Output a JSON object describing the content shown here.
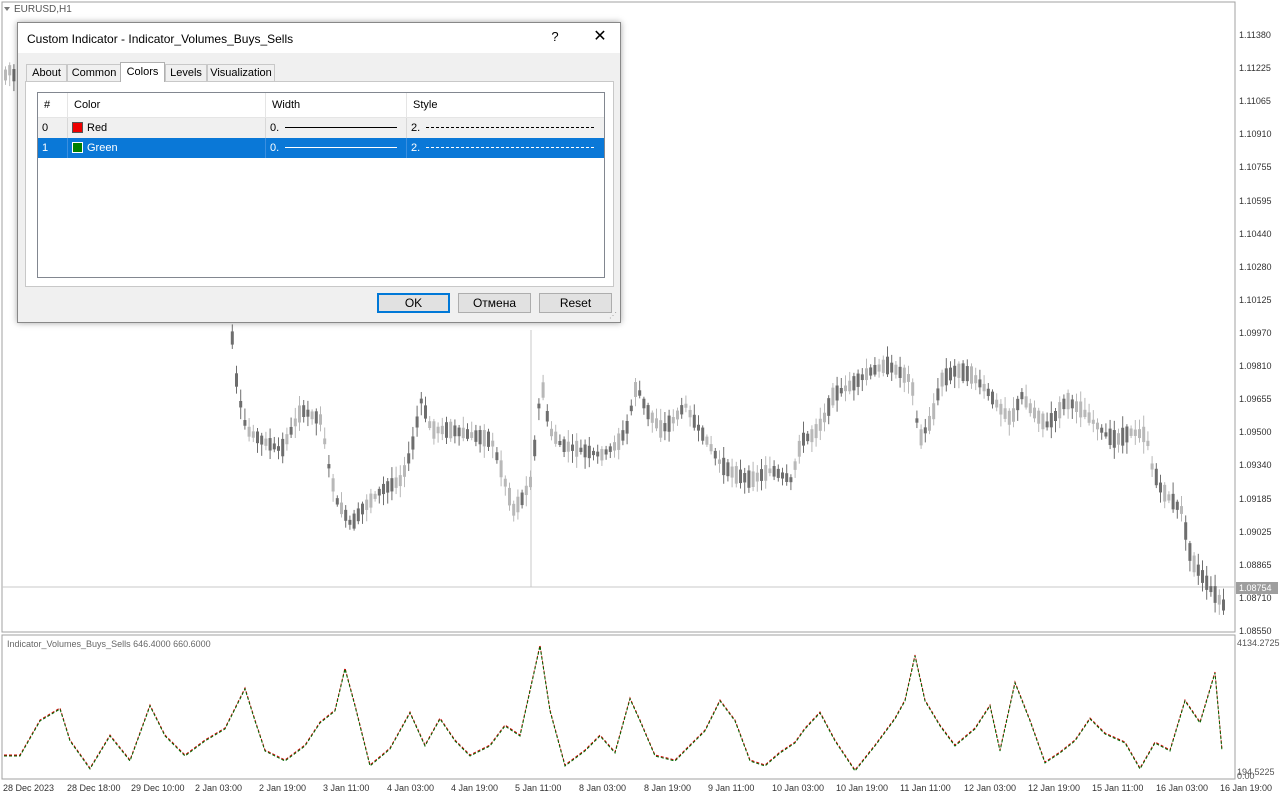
{
  "chart": {
    "symbol_title": "EURUSD,H1",
    "price_axis": [
      "1.11380",
      "1.11225",
      "1.11065",
      "1.10910",
      "1.10755",
      "1.10595",
      "1.10440",
      "1.10280",
      "1.10125",
      "1.09970",
      "1.09810",
      "1.09655",
      "1.09500",
      "1.09340",
      "1.09185",
      "1.09025",
      "1.08865",
      "1.08710",
      "1.08550"
    ],
    "current_price": "1.08754",
    "time_axis": [
      "28 Dec 2023",
      "28 Dec 18:00",
      "29 Dec 10:00",
      "2 Jan 03:00",
      "2 Jan 19:00",
      "3 Jan 11:00",
      "4 Jan 03:00",
      "4 Jan 19:00",
      "5 Jan 11:00",
      "8 Jan 03:00",
      "8 Jan 19:00",
      "9 Jan 11:00",
      "10 Jan 03:00",
      "10 Jan 19:00",
      "11 Jan 11:00",
      "12 Jan 03:00",
      "12 Jan 19:00",
      "15 Jan 11:00",
      "16 Jan 03:00",
      "16 Jan 19:00"
    ],
    "colors": {
      "candle_bull": "#b8b8b8",
      "candle_bear": "#6e6e6e",
      "grid": "#d4d4d4",
      "line_red": "#cc0000",
      "line_green": "#006600"
    }
  },
  "subwindow": {
    "label": "Indicator_Volumes_Buys_Sells 646.4000 660.6000",
    "max_label": "4134.2725",
    "min_label": "194.5225",
    "zero_label": "0.00"
  },
  "dialog": {
    "title": "Custom Indicator - Indicator_Volumes_Buys_Sells",
    "help": "?",
    "close": "✕",
    "tabs": [
      {
        "label": "About"
      },
      {
        "label": "Common"
      },
      {
        "label": "Colors"
      },
      {
        "label": "Levels"
      },
      {
        "label": "Visualization"
      }
    ],
    "active_tab": "Colors",
    "table": {
      "headers": [
        "#",
        "Color",
        "Width",
        "Style"
      ],
      "rows": [
        {
          "index": "0",
          "color_name": "Red",
          "swatch": "#ee0000",
          "width": "0.",
          "style": "2."
        },
        {
          "index": "1",
          "color_name": "Green",
          "swatch": "#008000",
          "width": "0.",
          "style": "2."
        }
      ]
    },
    "buttons": {
      "ok": "OK",
      "cancel": "Отмена",
      "reset": "Reset"
    },
    "grip": "⋰"
  }
}
